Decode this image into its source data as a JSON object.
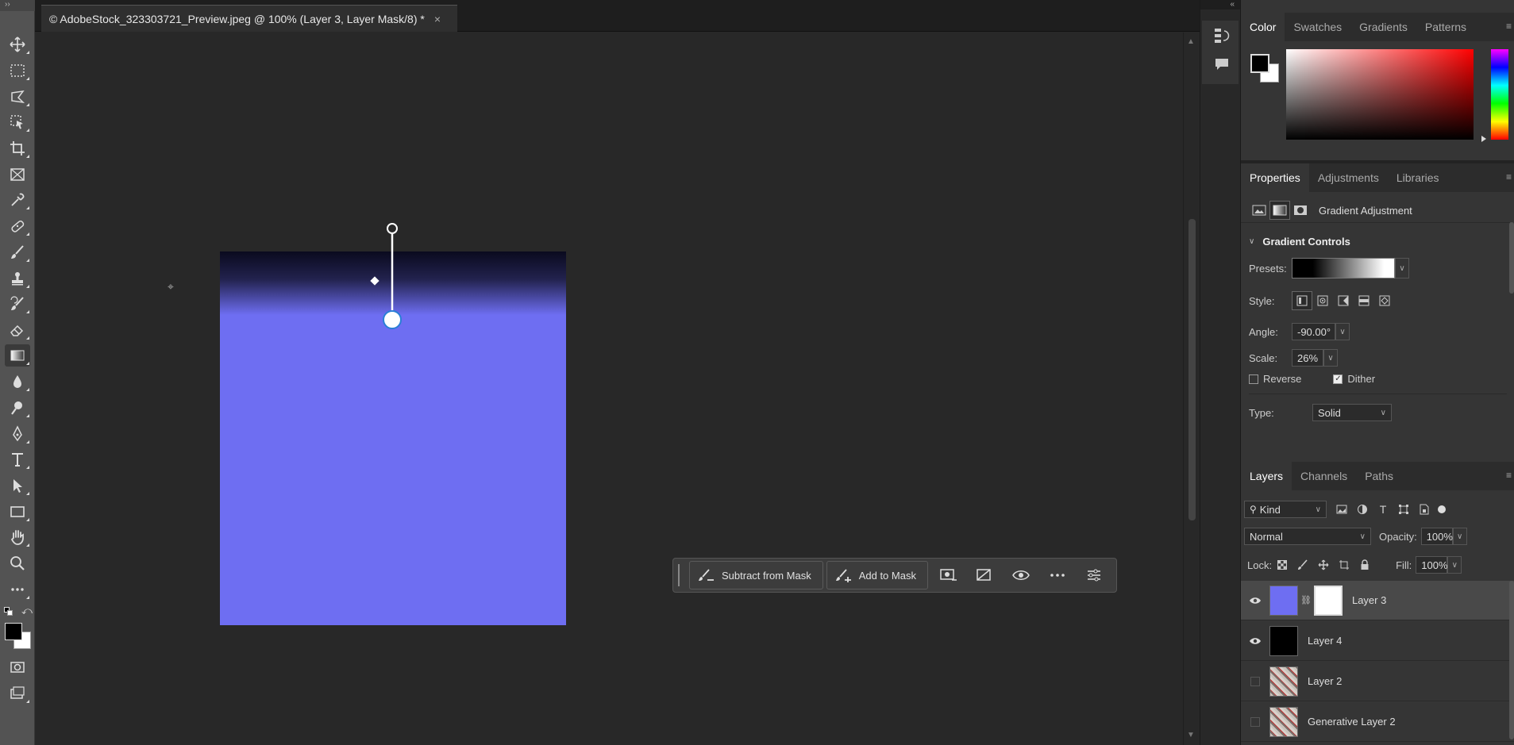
{
  "document": {
    "tab_title": "© AdobeStock_323303721_Preview.jpeg @ 100% (Layer 3, Layer Mask/8) *",
    "close_glyph": "×"
  },
  "toolbar": {
    "tools": [
      {
        "name": "move-tool-icon"
      },
      {
        "name": "marquee-tool-icon"
      },
      {
        "name": "lasso-tool-icon"
      },
      {
        "name": "object-select-tool-icon"
      },
      {
        "name": "crop-tool-icon"
      },
      {
        "name": "frame-tool-icon"
      },
      {
        "name": "eyedropper-tool-icon"
      },
      {
        "name": "healing-brush-tool-icon"
      },
      {
        "name": "brush-tool-icon"
      },
      {
        "name": "clone-stamp-tool-icon"
      },
      {
        "name": "history-brush-tool-icon"
      },
      {
        "name": "eraser-tool-icon"
      },
      {
        "name": "gradient-tool-icon"
      },
      {
        "name": "blur-tool-icon"
      },
      {
        "name": "dodge-tool-icon"
      },
      {
        "name": "pen-tool-icon"
      },
      {
        "name": "type-tool-icon"
      },
      {
        "name": "path-select-tool-icon"
      },
      {
        "name": "rectangle-tool-icon"
      },
      {
        "name": "hand-tool-icon"
      },
      {
        "name": "zoom-tool-icon"
      },
      {
        "name": "more-tools-icon"
      }
    ],
    "active_tool": "gradient-tool-icon",
    "foreground_color": "#000000",
    "background_color": "#ffffff"
  },
  "taskbar": {
    "subtract_label": "Subtract from Mask",
    "add_label": "Add to Mask"
  },
  "color_panel": {
    "tabs": [
      "Color",
      "Swatches",
      "Gradients",
      "Patterns"
    ],
    "active_tab": "Color",
    "hue_color": "#ff0000"
  },
  "properties": {
    "tabs": [
      "Properties",
      "Adjustments",
      "Libraries"
    ],
    "active_tab": "Properties",
    "type_label": "Gradient Adjustment",
    "section_title": "Gradient Controls",
    "presets_label": "Presets:",
    "style_label": "Style:",
    "angle_label": "Angle:",
    "angle_value": "-90.00°",
    "scale_label": "Scale:",
    "scale_value": "26%",
    "reverse_label": "Reverse",
    "reverse_checked": false,
    "dither_label": "Dither",
    "dither_checked": true,
    "type_field_label": "Type:",
    "type_value": "Solid"
  },
  "layers_panel": {
    "tabs": [
      "Layers",
      "Channels",
      "Paths"
    ],
    "active_tab": "Layers",
    "filter_label": "Kind",
    "blend_mode": "Normal",
    "opacity_label": "Opacity:",
    "opacity_value": "100%",
    "lock_label": "Lock:",
    "fill_label": "Fill:",
    "fill_value": "100%",
    "layers": [
      {
        "name": "Layer 3",
        "visible": true,
        "selected": true,
        "thumb_color": "#6e6ef2",
        "has_mask": true
      },
      {
        "name": "Layer 4",
        "visible": true,
        "selected": false,
        "thumb_color": "#000000",
        "has_mask": false
      },
      {
        "name": "Layer 2",
        "visible": false,
        "selected": false,
        "thumb_color": "#b8b0a8",
        "has_mask": false
      },
      {
        "name": "Generative Layer 2",
        "visible": false,
        "selected": false,
        "thumb_color": "#b8b0a8",
        "has_mask": false
      }
    ]
  },
  "canvas": {
    "fill_color": "#6e6ef2",
    "top_color": "#0a0a1e"
  }
}
